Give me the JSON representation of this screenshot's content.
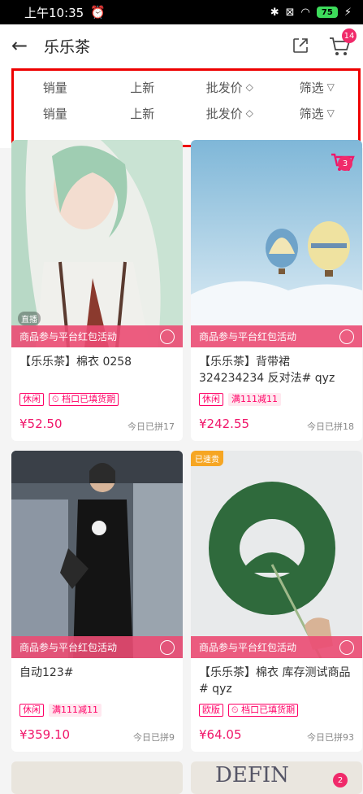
{
  "status": {
    "time": "上午10:35",
    "battery": "75"
  },
  "header": {
    "title": "乐乐茶",
    "cart_count": "14"
  },
  "filters": {
    "row1": [
      "销量",
      "上新",
      "批发价",
      "筛选"
    ],
    "row2": [
      "销量",
      "上新",
      "批发价",
      "筛选"
    ]
  },
  "products": [
    {
      "promo": "商品参与平台红包活动",
      "name": "【乐乐茶】棉衣 0258",
      "tags": [
        "休闲",
        "档口已填货期"
      ],
      "price": "¥52.50",
      "sold": "今日已拼17",
      "live": "直播"
    },
    {
      "promo": "商品参与平台红包活动",
      "name": "【乐乐茶】背带裙 324234234 反对法# qyz",
      "tags": [
        "休闲",
        "满111减11"
      ],
      "price": "¥242.55",
      "sold": "今日已拼18",
      "cart_count": "3"
    },
    {
      "promo": "商品参与平台红包活动",
      "name": "自动123#",
      "tags": [
        "休闲",
        "满111减11"
      ],
      "price": "¥359.10",
      "sold": "今日已拼9"
    },
    {
      "promo": "商品参与平台红包活动",
      "name": "【乐乐茶】棉衣 库存测试商品 # qyz",
      "tags": [
        "欧版",
        "档口已填货期"
      ],
      "price": "¥64.05",
      "sold": "今日已拼93",
      "corner": "已速贵"
    }
  ],
  "bottom_peek": {
    "text": "DEFIN",
    "badge": "2"
  },
  "colors": {
    "accent": "#f0166a",
    "promo": "#eb4b73",
    "highlight": "#e00000"
  }
}
